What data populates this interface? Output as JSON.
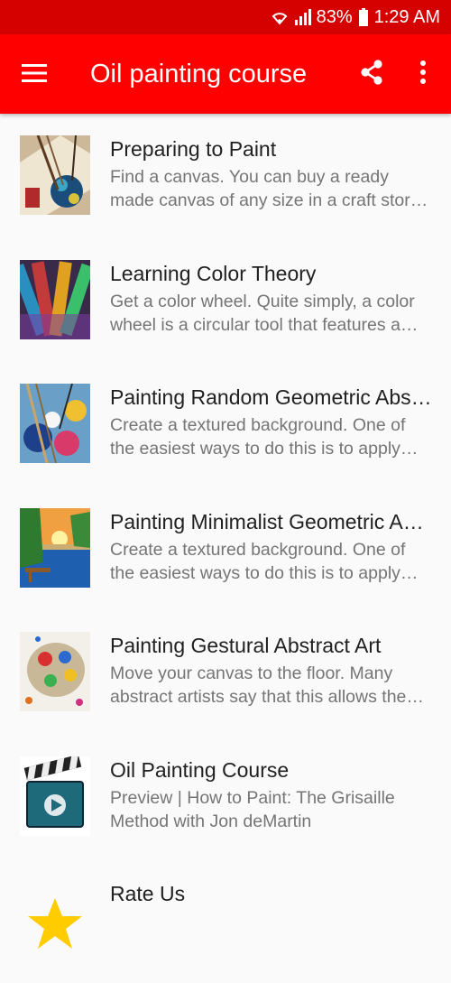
{
  "status_bar": {
    "battery": "83%",
    "time": "1:29 AM"
  },
  "app_bar": {
    "title": "Oil painting course",
    "menu_icon": "menu-icon",
    "share_icon": "share-icon",
    "more_icon": "more-vert-icon"
  },
  "colors": {
    "status_bar": "#d50000",
    "app_bar": "#ff0000",
    "title_text": "#212121",
    "desc_text": "#757575"
  },
  "items": [
    {
      "title": "Preparing to Paint",
      "desc": "Find a canvas. You can buy a ready made canvas of any size in a craft store. It will be pre-primed"
    },
    {
      "title": "Learning Color Theory",
      "desc": "Get a color wheel. Quite simply, a color wheel is a circular tool that features a variety of colors"
    },
    {
      "title": "Painting Random Geometric Abstract Art",
      "desc": "Create a textured background. One of the easiest ways to do this is to apply artist's gesso"
    },
    {
      "title": "Painting Minimalist Geometric Abstract Art",
      "desc": "Create a textured background. One of the easiest ways to do this is to apply artist's gesso"
    },
    {
      "title": "Painting Gestural Abstract Art",
      "desc": "Move your canvas to the floor. Many abstract artists say that this allows them more freedom"
    },
    {
      "title": "Oil Painting Course",
      "desc": "Preview | How to Paint: The Grisaille Method with Jon deMartin"
    },
    {
      "title": "Rate Us",
      "desc": ""
    }
  ]
}
